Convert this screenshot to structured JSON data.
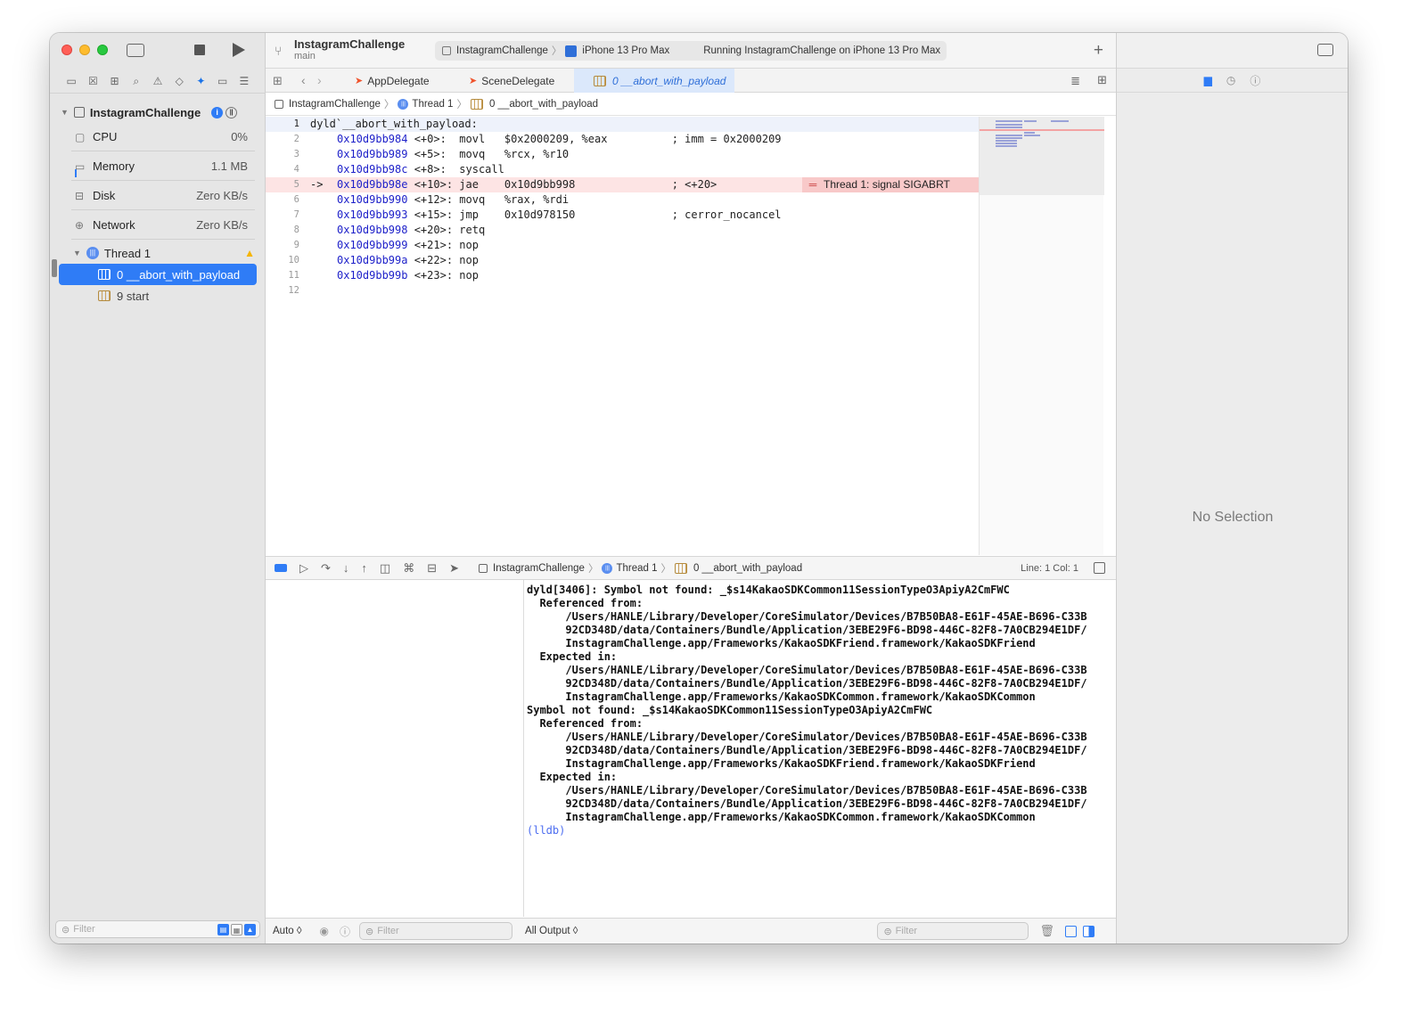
{
  "navigator": {
    "process_name": "InstagramChallenge",
    "gauges": [
      {
        "label": "CPU",
        "value": "0%"
      },
      {
        "label": "Memory",
        "value": "1.1 MB"
      },
      {
        "label": "Disk",
        "value": "Zero KB/s"
      },
      {
        "label": "Network",
        "value": "Zero KB/s"
      }
    ],
    "thread_label": "Thread 1",
    "frames": [
      {
        "label": "0 __abort_with_payload"
      },
      {
        "label": "9 start"
      }
    ],
    "filter_placeholder": "Filter"
  },
  "toolbar": {
    "scheme_title": "InstagramChallenge",
    "scheme_branch": "main",
    "activity_scheme": "InstagramChallenge",
    "activity_device": "iPhone 13 Pro Max",
    "activity_status": "Running InstagramChallenge on iPhone 13 Pro Max"
  },
  "tabs": [
    {
      "label": "AppDelegate"
    },
    {
      "label": "SceneDelegate"
    },
    {
      "label": "0 __abort_with_payload"
    }
  ],
  "jumpbar": {
    "project": "InstagramChallenge",
    "thread": "Thread 1",
    "frame": "0 __abort_with_payload"
  },
  "editor": {
    "lines": [
      {
        "num": "1",
        "arrow": "",
        "addr": "",
        "text": "dyld`__abort_with_payload:"
      },
      {
        "num": "2",
        "arrow": "",
        "addr": "0x10d9bb984",
        "text": " <+0>:  movl   $0x2000209, %eax          ; imm = 0x2000209"
      },
      {
        "num": "3",
        "arrow": "",
        "addr": "0x10d9bb989",
        "text": " <+5>:  movq   %rcx, %r10"
      },
      {
        "num": "4",
        "arrow": "",
        "addr": "0x10d9bb98c",
        "text": " <+8>:  syscall"
      },
      {
        "num": "5",
        "arrow": "->",
        "addr": "0x10d9bb98e",
        "text": " <+10>: jae    0x10d9bb998               ; <+20>"
      },
      {
        "num": "6",
        "arrow": "",
        "addr": "0x10d9bb990",
        "text": " <+12>: movq   %rax, %rdi"
      },
      {
        "num": "7",
        "arrow": "",
        "addr": "0x10d9bb993",
        "text": " <+15>: jmp    0x10d978150               ; cerror_nocancel"
      },
      {
        "num": "8",
        "arrow": "",
        "addr": "0x10d9bb998",
        "text": " <+20>: retq"
      },
      {
        "num": "9",
        "arrow": "",
        "addr": "0x10d9bb999",
        "text": " <+21>: nop"
      },
      {
        "num": "10",
        "arrow": "",
        "addr": "0x10d9bb99a",
        "text": " <+22>: nop"
      },
      {
        "num": "11",
        "arrow": "",
        "addr": "0x10d9bb99b",
        "text": " <+23>: nop"
      },
      {
        "num": "12",
        "arrow": "",
        "addr": "",
        "text": ""
      }
    ],
    "error_banner": "Thread 1: signal SIGABRT"
  },
  "debug_bar": {
    "project": "InstagramChallenge",
    "thread": "Thread 1",
    "frame": "0 __abort_with_payload",
    "line_col": "Line: 1  Col: 1"
  },
  "console": {
    "text": "dyld[3406]: Symbol not found: _$s14KakaoSDKCommon11SessionTypeO3ApiyA2CmFWC\n  Referenced from:\n      /Users/HANLE/Library/Developer/CoreSimulator/Devices/B7B50BA8-E61F-45AE-B696-C33B\n      92CD348D/data/Containers/Bundle/Application/3EBE29F6-BD98-446C-82F8-7A0CB294E1DF/\n      InstagramChallenge.app/Frameworks/KakaoSDKFriend.framework/KakaoSDKFriend\n  Expected in:\n      /Users/HANLE/Library/Developer/CoreSimulator/Devices/B7B50BA8-E61F-45AE-B696-C33B\n      92CD348D/data/Containers/Bundle/Application/3EBE29F6-BD98-446C-82F8-7A0CB294E1DF/\n      InstagramChallenge.app/Frameworks/KakaoSDKCommon.framework/KakaoSDKCommon\nSymbol not found: _$s14KakaoSDKCommon11SessionTypeO3ApiyA2CmFWC\n  Referenced from:\n      /Users/HANLE/Library/Developer/CoreSimulator/Devices/B7B50BA8-E61F-45AE-B696-C33B\n      92CD348D/data/Containers/Bundle/Application/3EBE29F6-BD98-446C-82F8-7A0CB294E1DF/\n      InstagramChallenge.app/Frameworks/KakaoSDKFriend.framework/KakaoSDKFriend\n  Expected in:\n      /Users/HANLE/Library/Developer/CoreSimulator/Devices/B7B50BA8-E61F-45AE-B696-C33B\n      92CD348D/data/Containers/Bundle/Application/3EBE29F6-BD98-446C-82F8-7A0CB294E1DF/\n      InstagramChallenge.app/Frameworks/KakaoSDKCommon.framework/KakaoSDKCommon",
    "prompt": "(lldb)"
  },
  "bottom_bar": {
    "auto_label": "Auto ◊",
    "filter_placeholder": "Filter",
    "output_label": "All Output ◊",
    "console_filter_placeholder": "Filter"
  },
  "inspector": {
    "empty_label": "No Selection"
  },
  "colors": {
    "accent": "#2f7cf6",
    "error_banner": "#f8c9c9",
    "address": "#1c1fc9"
  }
}
